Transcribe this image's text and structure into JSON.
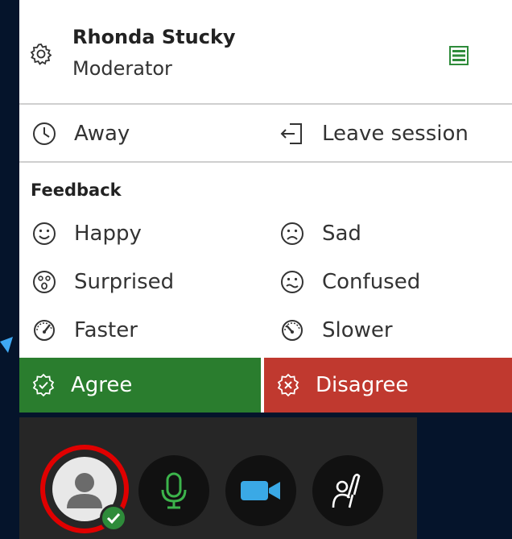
{
  "user": {
    "name": "Rhonda Stucky",
    "role": "Moderator"
  },
  "status": {
    "away_label": "Away",
    "leave_label": "Leave session"
  },
  "feedback": {
    "title": "Feedback",
    "items": [
      {
        "label": "Happy"
      },
      {
        "label": "Sad"
      },
      {
        "label": "Surprised"
      },
      {
        "label": "Confused"
      },
      {
        "label": "Faster"
      },
      {
        "label": "Slower"
      }
    ],
    "agree_label": "Agree",
    "disagree_label": "Disagree"
  },
  "colors": {
    "agree": "#2a7d2e",
    "disagree": "#c0392f",
    "mic": "#3cb44b",
    "camera": "#3aa9e6",
    "highlight_ring": "#e00000",
    "background": "#05142b"
  },
  "icons": {
    "settings": "gear-icon",
    "list": "list-icon",
    "away": "clock-icon",
    "leave": "leave-session-icon",
    "happy": "smile-icon",
    "sad": "frown-icon",
    "surprised": "surprised-face-icon",
    "confused": "confused-face-icon",
    "faster": "speedometer-fast-icon",
    "slower": "speedometer-slow-icon",
    "agree": "check-badge-icon",
    "disagree": "x-badge-icon",
    "avatar": "user-avatar-icon",
    "mic": "microphone-icon",
    "camera": "camera-icon",
    "hand": "raise-hand-icon"
  }
}
